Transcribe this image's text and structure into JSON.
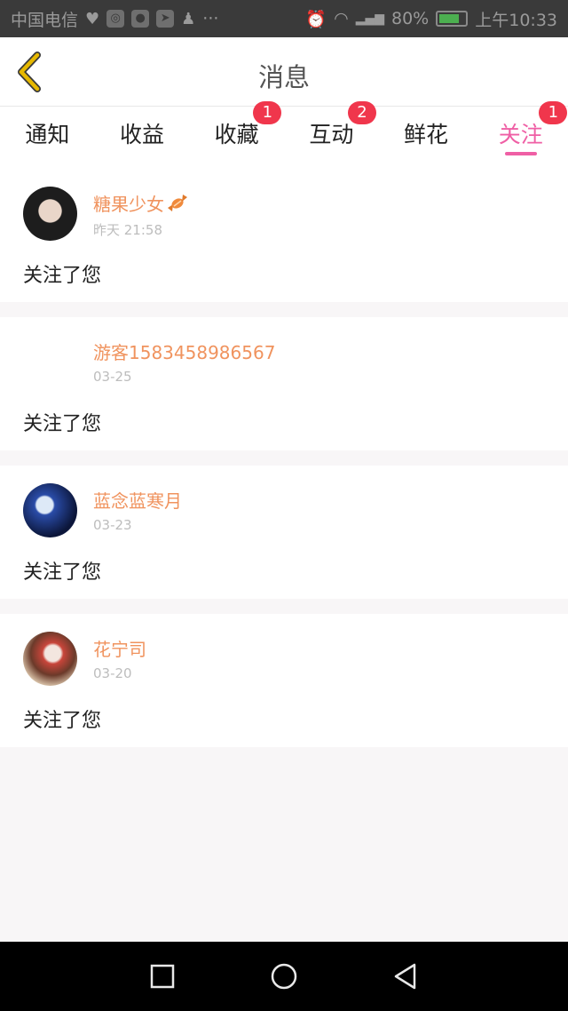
{
  "status_bar": {
    "carrier": "中国电信",
    "battery": "80%",
    "time": "上午10:33",
    "icons": [
      "heart-icon",
      "browser-icon",
      "chat-icon",
      "telegram-icon",
      "qq-icon",
      "more-dots-icon",
      "alarm-icon",
      "wifi-icon",
      "signal-icon",
      "battery-icon"
    ]
  },
  "header": {
    "title": "消息"
  },
  "tabs": [
    {
      "label": "通知",
      "badge": ""
    },
    {
      "label": "收益",
      "badge": ""
    },
    {
      "label": "收藏",
      "badge": "1"
    },
    {
      "label": "互动",
      "badge": "2"
    },
    {
      "label": "鲜花",
      "badge": ""
    },
    {
      "label": "关注",
      "badge": "1"
    }
  ],
  "active_tab": "关注",
  "items": [
    {
      "name": "糖果少女",
      "time": "昨天 21:58",
      "message": "关注了您"
    },
    {
      "name": "游客1583458986567",
      "time": "03-25",
      "message": "关注了您"
    },
    {
      "name": "蓝念蓝寒月",
      "time": "03-23",
      "message": "关注了您"
    },
    {
      "name": "花宁司",
      "time": "03-20",
      "message": "关注了您"
    }
  ],
  "colors": {
    "accent": "#ef5fa5",
    "badge": "#f0364c",
    "username": "#f0935e",
    "back_icon": "#e6b800"
  }
}
